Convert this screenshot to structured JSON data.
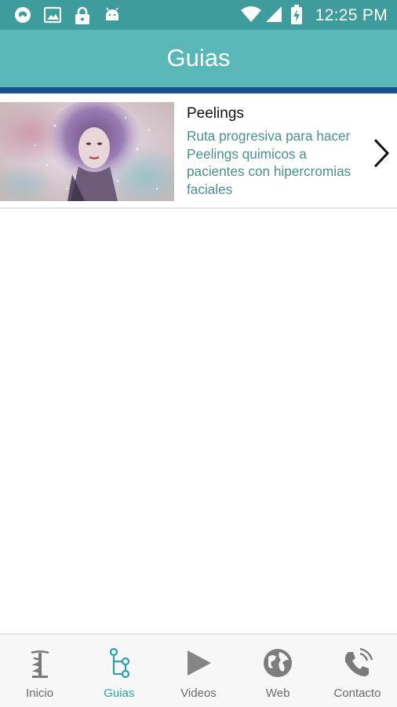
{
  "status_bar": {
    "time": "12:25 PM",
    "icons": [
      "whatsapp-icon",
      "image-icon",
      "lock-icon",
      "android-icon",
      "wifi-icon",
      "signal-icon",
      "battery-charging-icon"
    ]
  },
  "app_bar": {
    "title": "Guias"
  },
  "guides": [
    {
      "title": "Peelings",
      "description": "Ruta progresiva para hacer Peelings quimicos a pacientes con hipercromias faciales",
      "thumbnail": "watercolor-woman-portrait",
      "action_icon": "chevron-right-icon"
    }
  ],
  "bottom_nav": {
    "active": "Guias",
    "items": [
      {
        "label": "Inicio",
        "icon": "pharmacy-caduceus-icon"
      },
      {
        "label": "Guias",
        "icon": "flowchart-icon"
      },
      {
        "label": "Videos",
        "icon": "play-icon"
      },
      {
        "label": "Web",
        "icon": "globe-icon"
      },
      {
        "label": "Contacto",
        "icon": "phone-icon"
      }
    ]
  },
  "colors": {
    "status_bar": "#3e9c9d",
    "app_bar": "#5ab7b8",
    "app_bar_line": "#1c4f8f",
    "description_text": "#4b8f92",
    "nav_active": "#2aa3a8",
    "nav_inactive": "#6a6a6a"
  }
}
